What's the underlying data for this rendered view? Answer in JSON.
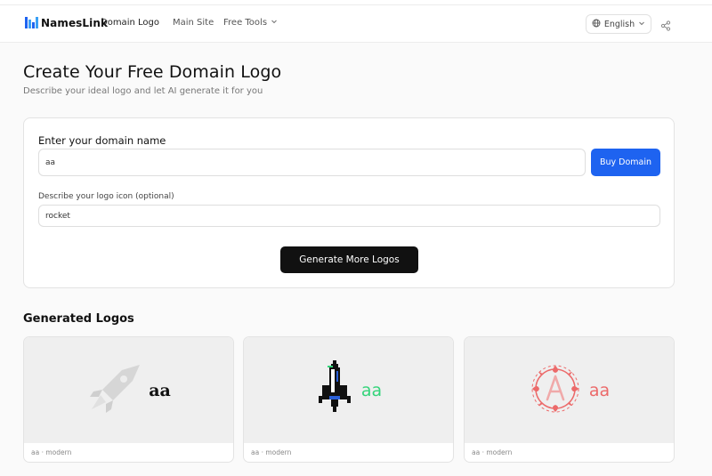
{
  "header": {
    "brand": "NamesLink",
    "product": "Domain Logo",
    "nav": {
      "main_site": "Main Site",
      "free_tools": "Free Tools"
    },
    "language": "English"
  },
  "page": {
    "title": "Create Your Free Domain Logo",
    "subtitle": "Describe your ideal logo and let AI generate it for you"
  },
  "form": {
    "domain_label": "Enter your domain name",
    "domain_value": "aa",
    "buy_button": "Buy Domain",
    "icon_label": "Describe your logo icon (optional)",
    "icon_value": "rocket",
    "generate_button": "Generate More Logos"
  },
  "generated": {
    "heading": "Generated Logos",
    "logos": [
      {
        "wordmark": "aa",
        "caption": "aa · modern",
        "wordmark_color": "#111111"
      },
      {
        "wordmark": "aa",
        "caption": "aa · modern",
        "wordmark_color": "#34d47a"
      },
      {
        "wordmark": "aa",
        "caption": "aa · modern",
        "wordmark_color": "#ec6a6a"
      }
    ]
  },
  "colors": {
    "accent": "#1e63f0",
    "dark_button": "#111111"
  }
}
